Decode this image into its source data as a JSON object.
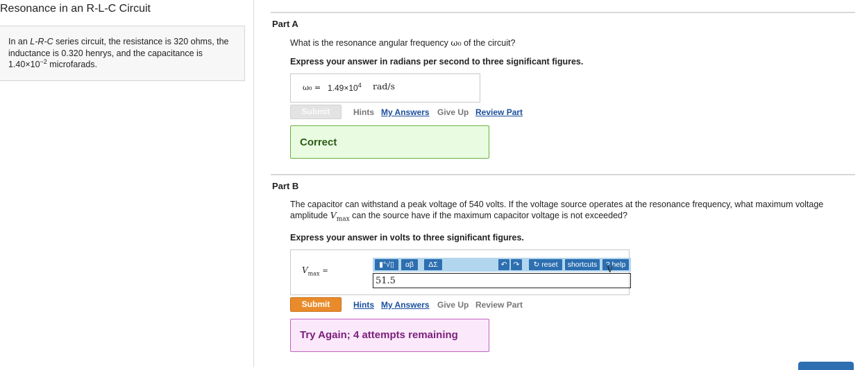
{
  "problem": {
    "title": "Resonance in an R-L-C Circuit",
    "text_pre": "In an ",
    "text_italic": "L-R-C",
    "text_mid": " series circuit, the resistance is 320 ohms, the inductance is 0.320 henrys, and the capacitance is 1.40×10",
    "text_exp": "−2",
    "text_post": " microfarads."
  },
  "partA": {
    "title": "Part A",
    "question_pre": "What is the resonance angular frequency ",
    "question_sym": "ω₀",
    "question_post": " of the circuit?",
    "instruction": "Express your answer in radians per second to three significant figures.",
    "answer_label": "ω₀ =",
    "answer_value": "1.49×10",
    "answer_exp": "4",
    "answer_unit": "rad/s",
    "submit_label": "Submit",
    "links": {
      "hints": "Hints",
      "my_answers": "My Answers",
      "give_up": "Give Up",
      "review": "Review Part"
    },
    "feedback": "Correct"
  },
  "partB": {
    "title": "Part B",
    "question_line1": "The capacitor can withstand a peak voltage of 540 volts. If the voltage source operates at the resonance frequency, what maximum voltage",
    "question_pre": "amplitude ",
    "question_sym": "V",
    "question_sub": "max",
    "question_post": " can the source have if the maximum capacitor voltage is not exceeded?",
    "instruction": "Express your answer in volts to three significant figures.",
    "answer_label_sym": "V",
    "answer_label_sub": "max",
    "answer_label_eq": "=",
    "answer_value": "51.5",
    "answer_unit": "V",
    "toolbar": {
      "templates": "▮°√▯",
      "greek": "αβ",
      "symbols": "ΔΣ",
      "reset": "reset",
      "shortcuts": "shortcuts",
      "help": "help"
    },
    "submit_label": "Submit",
    "links": {
      "hints": "Hints",
      "my_answers": "My Answers",
      "give_up": "Give Up",
      "review": "Review Part"
    },
    "feedback": "Try Again; 4 attempts remaining"
  }
}
